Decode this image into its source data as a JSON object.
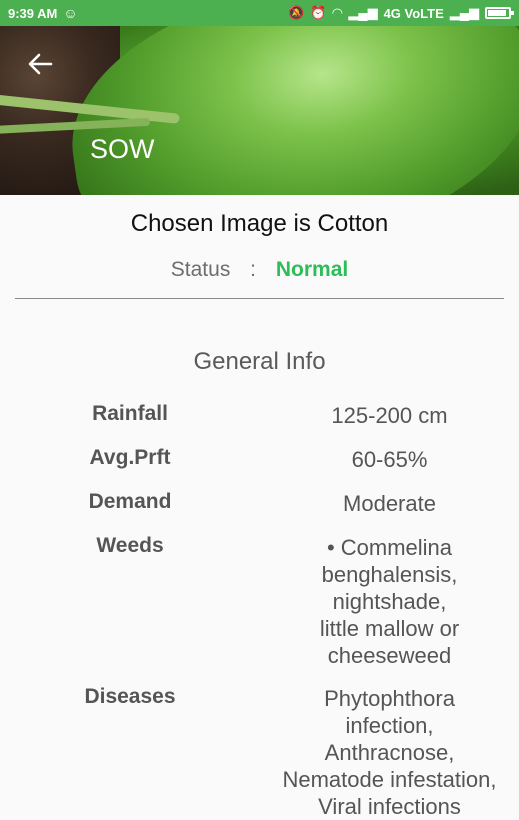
{
  "status_bar": {
    "time": "9:39 AM",
    "network": "4G VoLTE",
    "battery_level": 0.8
  },
  "header": {
    "back_icon": "arrow-left-icon",
    "title": "SOW"
  },
  "chosen_image_text": "Chosen Image is Cotton",
  "status": {
    "label": "Status",
    "separator": ":",
    "value": "Normal",
    "value_color": "#2ebd59"
  },
  "general_info": {
    "heading": "General Info",
    "rows": [
      {
        "label": "Rainfall",
        "value": "125-200 cm"
      },
      {
        "label": "Avg.Prft",
        "value": "60-65%"
      },
      {
        "label": "Demand",
        "value": "Moderate"
      },
      {
        "label": "Weeds",
        "lines": [
          "• Commelina",
          "benghalensis,",
          "nightshade,",
          "little mallow or",
          "cheeseweed"
        ]
      },
      {
        "label": "Diseases",
        "lines": [
          "Phytophthora",
          "infection,",
          "Anthracnose,",
          "Nematode infestation,",
          "Viral infections"
        ]
      }
    ]
  }
}
